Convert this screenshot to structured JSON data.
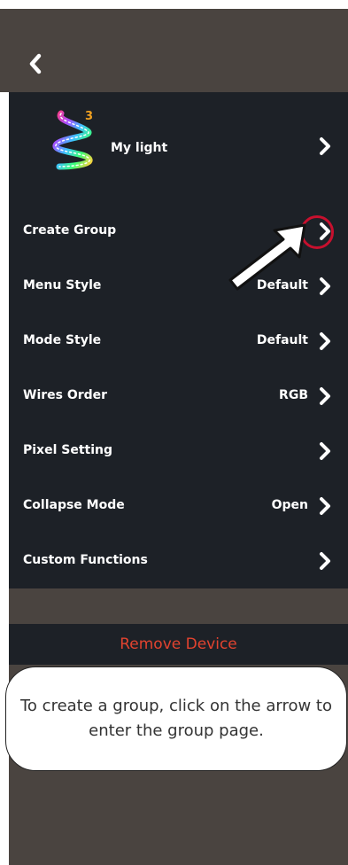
{
  "device": {
    "name": "My light",
    "badge": "3"
  },
  "settings": [
    {
      "label": "Create Group",
      "value": ""
    },
    {
      "label": "Menu Style",
      "value": "Default"
    },
    {
      "label": "Mode Style",
      "value": "Default"
    },
    {
      "label": "Wires Order",
      "value": "RGB"
    },
    {
      "label": "Pixel Setting",
      "value": ""
    },
    {
      "label": "Collapse Mode",
      "value": "Open"
    },
    {
      "label": "Custom Functions",
      "value": ""
    }
  ],
  "remove_label": "Remove Device",
  "tooltip": {
    "text": "To create a group, click on the arrow to enter the group page."
  },
  "colors": {
    "background": "#4a4440",
    "panel": "#1d2127",
    "danger": "#e2432f",
    "highlight": "#c8102e"
  },
  "icons": {
    "back": "chevron-left-icon",
    "row": "chevron-right-icon",
    "pointer": "arrow-pointer-icon"
  }
}
